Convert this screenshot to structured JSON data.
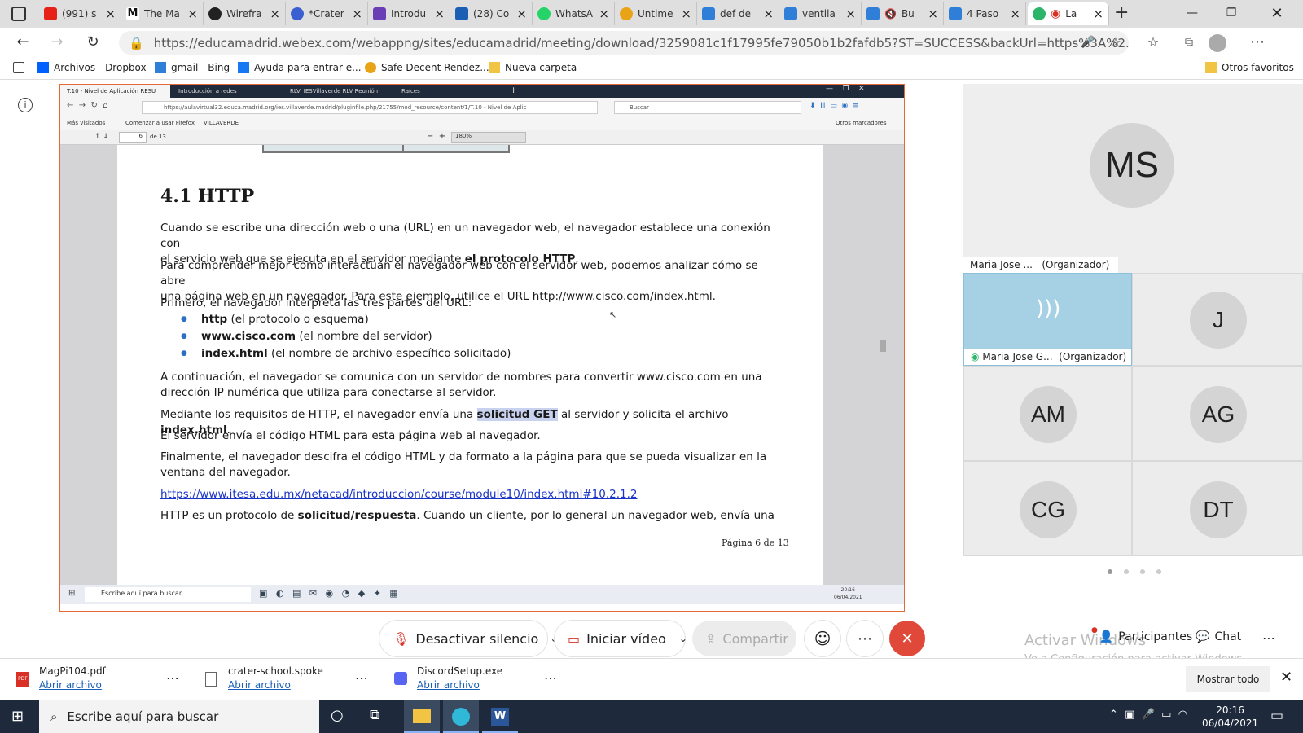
{
  "browser": {
    "tabs": [
      {
        "label": "(991) s",
        "color": "#e62117"
      },
      {
        "label": "The Ma",
        "color": "#222222"
      },
      {
        "label": "Wirefra",
        "color": "#222222"
      },
      {
        "label": "*Crater",
        "color": "#3a5fd0"
      },
      {
        "label": "Introdu",
        "color": "#6a3fb5"
      },
      {
        "label": "(28) Co",
        "color": "#1a5fb4"
      },
      {
        "label": "WhatsA",
        "color": "#25d366"
      },
      {
        "label": "Untime",
        "color": "#e8a317"
      },
      {
        "label": "def de",
        "color": "#2f7fd8"
      },
      {
        "label": "ventila",
        "color": "#2f7fd8"
      },
      {
        "label": "Bu",
        "color": "#2f7fd8"
      },
      {
        "label": "4 Paso",
        "color": "#2f7fd8"
      },
      {
        "label": "La",
        "color": "#d93025"
      }
    ],
    "url": "https://educamadrid.webex.com/webappng/sites/educamadrid/meeting/download/3259081c1f17995fe79050b1b2fafdb5?ST=SUCCESS&backUrl=https%3A%2...",
    "bookmarks": [
      "Archivos - Dropbox",
      "gmail - Bing",
      "Ayuda para entrar e...",
      "Safe Decent Rendez...",
      "Nueva carpeta"
    ],
    "other_favorites": "Otros favoritos"
  },
  "shared": {
    "tabs": [
      "T.10 - Nivel de Aplicación RESU",
      "Introducción a redes",
      "RLV: IESVillaverde RLV Reunión",
      "Raíces"
    ],
    "url": "https://aulavirtual32.educa.madrid.org/ies.villaverde.madrid/pluginfile.php/21755/mod_resource/content/1/T.10 - Nivel de Aplic",
    "search_placeholder": "Buscar",
    "bookmarks": [
      "Más visitados",
      "Comenzar a usar Firefox",
      "VILLAVERDE"
    ],
    "other_bookmarks": "Otros marcadores",
    "page_num": "6",
    "page_of": "de 13",
    "zoom": "180%",
    "task_search": "Escribe aquí para buscar",
    "task_time": "20:16",
    "task_date": "06/04/2021"
  },
  "doc": {
    "heading": "4.1  HTTP",
    "p1a": "Cuando se escribe una dirección web o una (URL) en un navegador web, el navegador establece una conexión con",
    "p1b": "el servicio web que se ejecuta en el servidor mediante ",
    "p1b_bold": "el protocolo HTTP",
    "p1b_end": ".",
    "p2a": "Para comprender mejor cómo interactúan el navegador web con el servidor web, podemos analizar cómo se abre",
    "p2b": "una página web en un navegador. Para este ejemplo, utilice el URL http://www.cisco.com/index.html.",
    "p3": "Primero, el navegador interpreta las tres partes del URL:",
    "bullets": [
      {
        "bold": "http",
        "rest": " (el protocolo o esquema)"
      },
      {
        "bold": "www.cisco.com",
        "rest": " (el nombre del servidor)"
      },
      {
        "bold": "index.html",
        "rest": " (el nombre de archivo específico solicitado)"
      }
    ],
    "p4a": "A continuación, el navegador se comunica con un servidor de nombres para convertir www.cisco.com en una",
    "p4b": "dirección IP numérica que utiliza para conectarse al servidor.",
    "p5a": "Mediante los requisitos de HTTP, el navegador envía una ",
    "p5_hl": "solicitud GET",
    "p5b": " al servidor y solicita el archivo ",
    "p5_bold": "index.html",
    "p5_end": ".",
    "p6": "El servidor envía el código HTML para esta página web al navegador.",
    "p7a": "Finalmente, el navegador descifra el código HTML y da formato a la página para que se pueda visualizar en la",
    "p7b": "ventana del navegador.",
    "link": "https://www.itesa.edu.mx/netacad/introduccion/course/module10/index.html#10.2.1.2",
    "p8a": "HTTP es un protocolo de ",
    "p8_bold": "solicitud/respuesta",
    "p8b": ". Cuando un cliente, por lo general un navegador web, envía una",
    "footer": "Página 6 de 13"
  },
  "participants": {
    "main": {
      "initials": "MS",
      "name": "Maria Jose ...",
      "role": "(Organizador)"
    },
    "active": {
      "name": "Maria Jose G...",
      "role": "(Organizador)"
    },
    "grid": [
      "J",
      "AM",
      "AG",
      "CG",
      "DT"
    ]
  },
  "controls": {
    "mute": "Desactivar silencio",
    "video": "Iniciar vídeo",
    "share": "Compartir",
    "participants": "Participantes",
    "chat": "Chat"
  },
  "watermark": {
    "line1": "Activar Windows",
    "line2": "Ve a Configuración para activar Windows."
  },
  "downloads": {
    "items": [
      {
        "name": "MagPi104.pdf",
        "action": "Abrir archivo"
      },
      {
        "name": "crater-school.spoke",
        "action": "Abrir archivo"
      },
      {
        "name": "DiscordSetup.exe",
        "action": "Abrir archivo"
      }
    ],
    "show_all": "Mostrar todo"
  },
  "taskbar": {
    "search": "Escribe aquí para buscar",
    "time": "20:16",
    "date": "06/04/2021"
  }
}
